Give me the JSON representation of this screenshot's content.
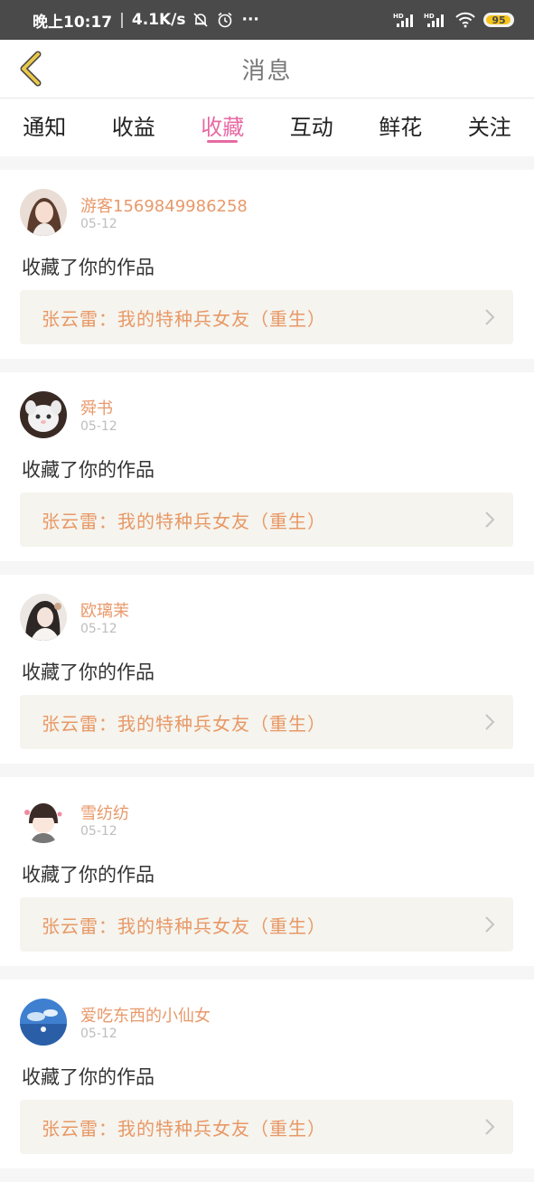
{
  "status_bar": {
    "time": "晚上10:17",
    "separator": "|",
    "speed": "4.1K/s",
    "dots": "···",
    "signal1_label": "HD",
    "signal2_label": "HD",
    "battery": "95",
    "battery_fraction": 0.95,
    "icons": [
      "mute-bell-icon",
      "alarm-icon",
      "more-icon",
      "signal-icon",
      "signal-icon",
      "wifi-icon",
      "battery-icon"
    ]
  },
  "header": {
    "title": "消息",
    "back_icon": "chevron-left-icon",
    "back_color": "#e8c84a"
  },
  "tabs": [
    {
      "label": "通知",
      "active": false
    },
    {
      "label": "收益",
      "active": false
    },
    {
      "label": "收藏",
      "active": true
    },
    {
      "label": "互动",
      "active": false
    },
    {
      "label": "鲜花",
      "active": false
    },
    {
      "label": "关注",
      "active": false
    }
  ],
  "colors": {
    "accent": "#e76aa3",
    "username": "#e8996a",
    "work_title": "#e89866",
    "work_bg": "#f5f4ee"
  },
  "feed": [
    {
      "user": "游客1569849986258",
      "date": "05-12",
      "action": "收藏了你的作品",
      "work": "张云雷：我的特种兵女友（重生）",
      "avatar": "avatar-girl-photo"
    },
    {
      "user": "舜书",
      "date": "05-12",
      "action": "收藏了你的作品",
      "work": "张云雷：我的特种兵女友（重生）",
      "avatar": "avatar-white-plush"
    },
    {
      "user": "欧璃茉",
      "date": "05-12",
      "action": "收藏了你的作品",
      "work": "张云雷：我的特种兵女友（重生）",
      "avatar": "avatar-girl-illustration"
    },
    {
      "user": "雪纺纺",
      "date": "05-12",
      "action": "收藏了你的作品",
      "work": "张云雷：我的特种兵女友（重生）",
      "avatar": "avatar-chibi-boy"
    },
    {
      "user": "爱吃东西的小仙女",
      "date": "05-12",
      "action": "收藏了你的作品",
      "work": "张云雷：我的特种兵女友（重生）",
      "avatar": "avatar-blue-sky"
    }
  ]
}
